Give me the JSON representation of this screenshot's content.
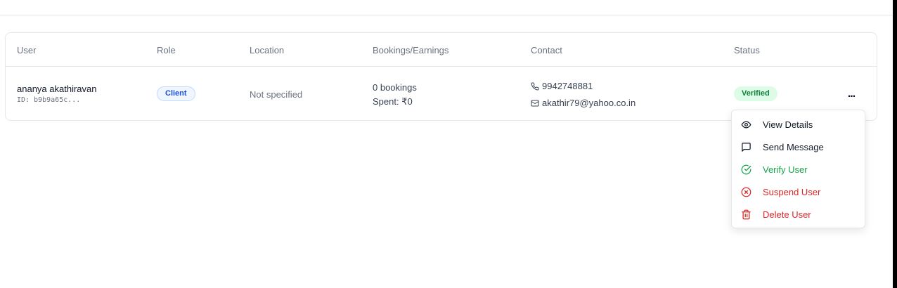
{
  "table": {
    "headers": {
      "user": "User",
      "role": "Role",
      "location": "Location",
      "bookings": "Bookings/Earnings",
      "contact": "Contact",
      "status": "Status"
    },
    "rows": [
      {
        "name": "ananya akathiravan",
        "id": "ID: b9b9a65c...",
        "role": "Client",
        "location": "Not specified",
        "bookings": "0 bookings",
        "spent": "Spent: ₹0",
        "phone": "9942748881",
        "email": "akathir79@yahoo.co.in",
        "status": "Verified"
      }
    ]
  },
  "actions_menu": {
    "trigger_label": "...",
    "items": [
      {
        "label": "View Details",
        "icon": "eye-icon"
      },
      {
        "label": "Send Message",
        "icon": "message-square-icon"
      },
      {
        "label": "Verify User",
        "icon": "check-circle-icon"
      },
      {
        "label": "Suspend User",
        "icon": "x-circle-icon"
      },
      {
        "label": "Delete User",
        "icon": "trash-icon"
      }
    ]
  },
  "colors": {
    "role_badge_bg": "#eff6ff",
    "role_badge_text": "#1d4ed8",
    "status_badge_bg": "#dcfce7",
    "status_badge_text": "#15803d",
    "verify_green": "#16a34a",
    "danger_red": "#dc2626"
  }
}
